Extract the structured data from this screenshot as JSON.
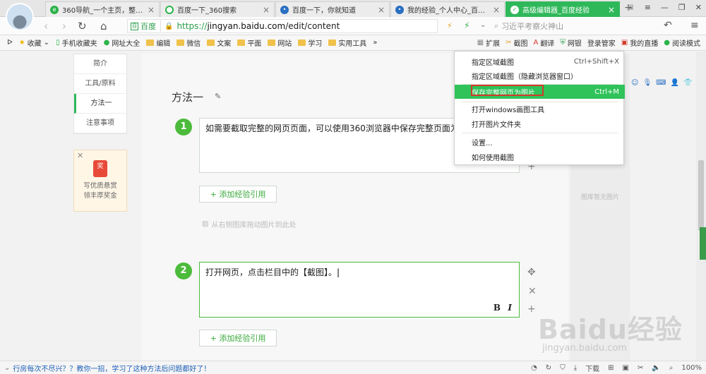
{
  "browser": {
    "tabs": [
      {
        "title": "360导航_一个主页，整个世界",
        "icon": "360-icon",
        "color": "#2db34a",
        "active": false
      },
      {
        "title": "百度一下_360搜索",
        "icon": "360search-icon",
        "color": "#2db34a",
        "active": false
      },
      {
        "title": "百度一下，你就知道",
        "icon": "baidu-paw-icon",
        "color": "#2a6fc2",
        "active": false
      },
      {
        "title": "我的经验_个人中心_百度经验",
        "icon": "baidu-paw-icon",
        "color": "#2a6fc2",
        "active": false
      },
      {
        "title": "高级编辑器_百度经验",
        "icon": "jingyan-icon",
        "color": "#ffffff",
        "active": true
      }
    ],
    "address": {
      "badge": "百度",
      "scheme": "https://",
      "host": "jingyan.baidu.com",
      "path": "/edit/content"
    },
    "search_placeholder": "习近平考察火神山",
    "bookmarks": [
      "收藏",
      "手机收藏夹",
      "网址大全",
      "编辑",
      "微信",
      "文案",
      "平面",
      "网站",
      "学习",
      "实用工具"
    ],
    "bookmarks_more": "»",
    "toolbar_right": [
      "扩展",
      "截图",
      "翻译",
      "网银",
      "登录管家",
      "我的直播",
      "阅读模式"
    ]
  },
  "sidebar": {
    "items": [
      "简介",
      "工具/原料",
      "方法一",
      "注意事项"
    ],
    "active": 2,
    "promo": {
      "badge": "奖",
      "line1": "写优质悬赏",
      "line2": "领丰厚奖金"
    }
  },
  "editor": {
    "section_title": "方法一",
    "steps": [
      {
        "num": "1",
        "text": "如需要截取完整的网页页面，可以使用360浏览器中保存完整页面为图片的功能。"
      },
      {
        "num": "2",
        "text": "打开网页，点击栏目中的【截图】。"
      }
    ],
    "add_ref_label": "+ 添加经验引用",
    "drag_hint": "从右侧图库拖动图片到此处",
    "bold_label": "B",
    "italic_label": "I"
  },
  "right_panel": {
    "empty_text": "图库暂无图片"
  },
  "screenshot_menu": {
    "items": [
      {
        "label": "指定区域截图",
        "shortcut": "Ctrl+Shift+X"
      },
      {
        "label": "指定区域截图（隐藏浏览器窗口）",
        "shortcut": ""
      },
      {
        "label": "保存完整网页为图片",
        "shortcut": "Ctrl+M"
      },
      {
        "label": "打开windows画图工具",
        "shortcut": ""
      },
      {
        "label": "打开图片文件夹",
        "shortcut": ""
      },
      {
        "label": "设置...",
        "shortcut": ""
      },
      {
        "label": "如何使用截图",
        "shortcut": ""
      }
    ],
    "highlighted": 2
  },
  "watermark": {
    "logo": "Baidu经验",
    "url": "jingyan.baidu.com"
  },
  "statusbar": {
    "tip": "行房每次不尽兴？？教你一招，学习了这种方法后问题都好了！",
    "download": "下载",
    "zoom": "100%"
  }
}
